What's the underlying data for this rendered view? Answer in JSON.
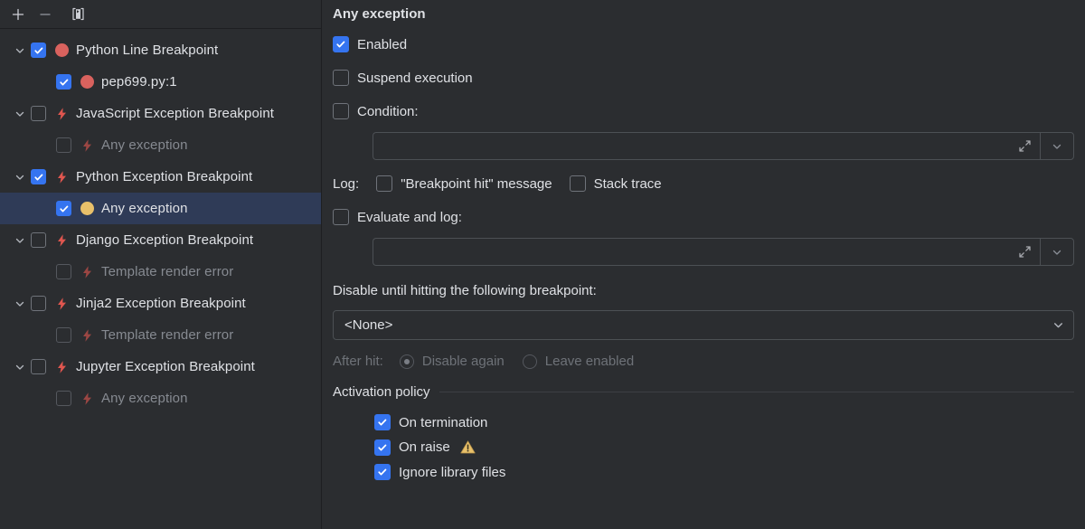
{
  "toolbar": {
    "add_label": "+",
    "remove_label": "−",
    "view_label": "[◧]",
    "icons": [
      "plus-icon",
      "minus-icon",
      "view-breakpoints-icon"
    ]
  },
  "tree": {
    "items": [
      {
        "label": "Python Line Breakpoint",
        "depth": 0,
        "expandable": true,
        "checked": true,
        "icon": "breakpoint-dot-red",
        "dim": false
      },
      {
        "label": "pep699.py:1",
        "depth": 1,
        "expandable": false,
        "checked": true,
        "icon": "breakpoint-dot-red",
        "dim": false
      },
      {
        "label": "JavaScript Exception Breakpoint",
        "depth": 0,
        "expandable": true,
        "checked": false,
        "icon": "exception-bolt-red",
        "dim": false
      },
      {
        "label": "Any exception",
        "depth": 1,
        "expandable": false,
        "checked": false,
        "icon": "exception-bolt-red-dim",
        "dim": true
      },
      {
        "label": "Python Exception Breakpoint",
        "depth": 0,
        "expandable": true,
        "checked": true,
        "icon": "exception-bolt-red",
        "dim": false
      },
      {
        "label": "Any exception",
        "depth": 1,
        "expandable": false,
        "checked": true,
        "icon": "breakpoint-dot-yellow",
        "dim": false,
        "selected": true
      },
      {
        "label": "Django Exception Breakpoint",
        "depth": 0,
        "expandable": true,
        "checked": false,
        "icon": "exception-bolt-red",
        "dim": false
      },
      {
        "label": "Template render error",
        "depth": 1,
        "expandable": false,
        "checked": false,
        "icon": "exception-bolt-red-dim",
        "dim": true
      },
      {
        "label": "Jinja2 Exception Breakpoint",
        "depth": 0,
        "expandable": true,
        "checked": false,
        "icon": "exception-bolt-red",
        "dim": false
      },
      {
        "label": "Template render error",
        "depth": 1,
        "expandable": false,
        "checked": false,
        "icon": "exception-bolt-red-dim",
        "dim": true
      },
      {
        "label": "Jupyter Exception Breakpoint",
        "depth": 0,
        "expandable": true,
        "checked": false,
        "icon": "exception-bolt-red",
        "dim": false
      },
      {
        "label": "Any exception",
        "depth": 1,
        "expandable": false,
        "checked": false,
        "icon": "exception-bolt-red-dim",
        "dim": true
      }
    ]
  },
  "details": {
    "title": "Any exception",
    "enabled": {
      "label": "Enabled",
      "checked": true
    },
    "suspend": {
      "label": "Suspend execution",
      "checked": false
    },
    "condition": {
      "label": "Condition:",
      "checked": false,
      "value": "",
      "placeholder": ""
    },
    "log": {
      "label": "Log:",
      "breakpoint_hit": {
        "label": "\"Breakpoint hit\" message",
        "checked": false
      },
      "stack_trace": {
        "label": "Stack trace",
        "checked": false
      }
    },
    "evaluate_and_log": {
      "label": "Evaluate and log:",
      "checked": false,
      "value": "",
      "placeholder": ""
    },
    "disable_until": {
      "label": "Disable until hitting the following breakpoint:",
      "selected": "<None>"
    },
    "after_hit": {
      "label": "After hit:",
      "disable_again": {
        "label": "Disable again",
        "selected": true
      },
      "leave_enabled": {
        "label": "Leave enabled",
        "selected": false
      }
    },
    "activation_policy": {
      "title": "Activation policy",
      "items": [
        {
          "label": "On termination",
          "checked": true,
          "warning": false
        },
        {
          "label": "On raise",
          "checked": true,
          "warning": true
        },
        {
          "label": "Ignore library files",
          "checked": true,
          "warning": false
        }
      ]
    }
  },
  "colors": {
    "background": "#2B2D30",
    "accent_blue": "#3574F0",
    "selection_blue": "#2F3B57",
    "breakpoint_red": "#D9625E",
    "breakpoint_yellow": "#E8C06A",
    "warning_amber": "#E8C06A",
    "text": "#DFE1E5",
    "text_dim": "#868A91",
    "border": "#4C5054"
  }
}
